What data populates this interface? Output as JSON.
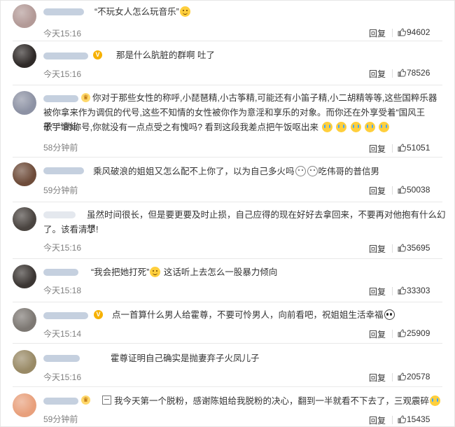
{
  "reply_label": "回复",
  "comments": [
    {
      "avatar_color": "#b39a97",
      "name_width": 58,
      "badge": "",
      "parts": [
        "“不玩女人怎么玩音乐”",
        ""
      ],
      "emojis": [
        "smile"
      ],
      "time": "今天15:16",
      "likes": "94602"
    },
    {
      "avatar_color": "#2f2a28",
      "name_width": 64,
      "badge": "V",
      "parts": [
        "那是什么肮脏的群啊 吐了"
      ],
      "emojis": [],
      "time": "今天15:16",
      "likes": "78526"
    },
    {
      "avatar_color": "#8d92a4",
      "name_width": 50,
      "badge": "crown",
      "lines": [
        "你对于那些女性的称呼,小琵琶精,小古筝精,可能还有小笛子精,小二胡精等等,这些国粹乐器",
        "被你拿来作为调侃的代号,这些不知情的女性被你作为意淫和享乐的对象。而你还在外享受着“国风王子”,“谪仙",
        "歌手”的称号,你就没有一点点受之有愧吗? 看到这段我差点把午饭呕出来"
      ],
      "emojis": [
        "cry",
        "cry",
        "cry",
        "cry",
        "cry"
      ],
      "time": "58分钟前",
      "likes": "51051"
    },
    {
      "avatar_color": "#6e4c3a",
      "name_width": 58,
      "badge": "",
      "parts": [
        "乘风破浪的姐姐又怎么配不上你了，以为自己多火吗",
        "吃伟哥的普信男"
      ],
      "emojis": [
        "plain",
        "plain"
      ],
      "time": "59分钟前",
      "likes": "50038"
    },
    {
      "avatar_color": "#4a4440",
      "name_width": 0,
      "badge": "",
      "lines": [
        "虽然时间很长，但是要更要及时止损，自己应得的现在好好去拿回来，不要再对他抱有什么幻想",
        "了。该看清了!"
      ],
      "emojis": [],
      "time": "今天15:16",
      "likes": "35695"
    },
    {
      "avatar_color": "#3b3633",
      "name_width": 50,
      "badge": "",
      "parts": [
        "“我会把她打死”",
        "这话听上去怎么一股暴力倾向"
      ],
      "emojis": [
        "smile"
      ],
      "time": "今天15:18",
      "likes": "33303"
    },
    {
      "avatar_color": "#7d7873",
      "name_width": 64,
      "badge": "V",
      "parts": [
        "点一首算什么男人给霍尊，不要可怜男人，向前看吧，祝姐姐生活幸福"
      ],
      "emojis": [
        "panda"
      ],
      "time": "今天15:14",
      "likes": "25909"
    },
    {
      "avatar_color": "#998a66",
      "name_width": 52,
      "badge": "",
      "parts": [
        "霍尊证明自己确实是抛妻弃子火凤儿子"
      ],
      "emojis": [],
      "time": "今天15:16",
      "likes": "20578"
    },
    {
      "avatar_color": "#e8a07c",
      "name_width": 50,
      "badge": "crown",
      "parts": [
        "我今天第一个脱粉，感谢陈姐给我脱粉的决心，翻到一半就看不下去了，三观震碎"
      ],
      "emojis": [
        "cry"
      ],
      "time": "59分钟前",
      "likes": "15435"
    }
  ]
}
